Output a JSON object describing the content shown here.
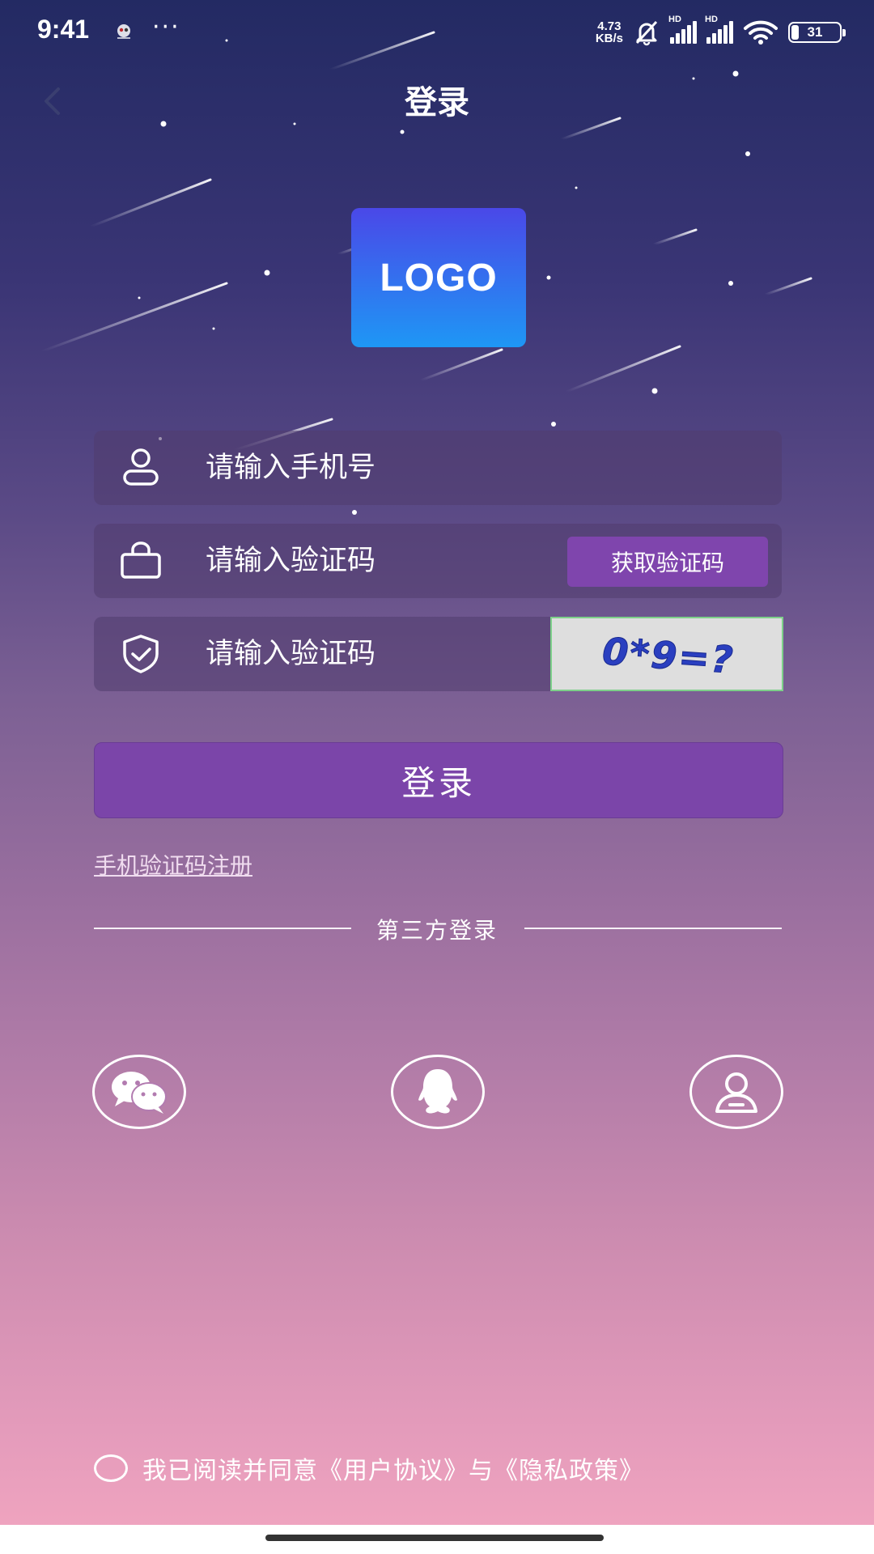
{
  "status_bar": {
    "time": "9:41",
    "dots": "···",
    "net_speed_value": "4.73",
    "net_speed_unit": "KB/s",
    "sim1_label": "HD",
    "sim2_label": "HD",
    "battery": "31",
    "battery_level_percent": 31
  },
  "header": {
    "title": "登录"
  },
  "logo": {
    "text": "LOGO"
  },
  "form": {
    "phone_placeholder": "请输入手机号",
    "sms_code_placeholder": "请输入验证码",
    "get_code_label": "获取验证码",
    "captcha_placeholder": "请输入验证码",
    "captcha_text": "0*9=?"
  },
  "login_button": "登录",
  "register_link": "手机验证码注册",
  "third_party": {
    "title": "第三方登录",
    "items": [
      "wechat-icon",
      "qq-icon",
      "user-icon"
    ]
  },
  "agreement": {
    "text": "我已阅读并同意《用户协议》与《隐私政策》"
  },
  "colors": {
    "accent_purple": "#7b45a9",
    "logo_gradient_top": "#4a48e8",
    "logo_gradient_bottom": "#1e97f5",
    "background_top": "#232a63",
    "background_bottom": "#f2a6c0"
  }
}
